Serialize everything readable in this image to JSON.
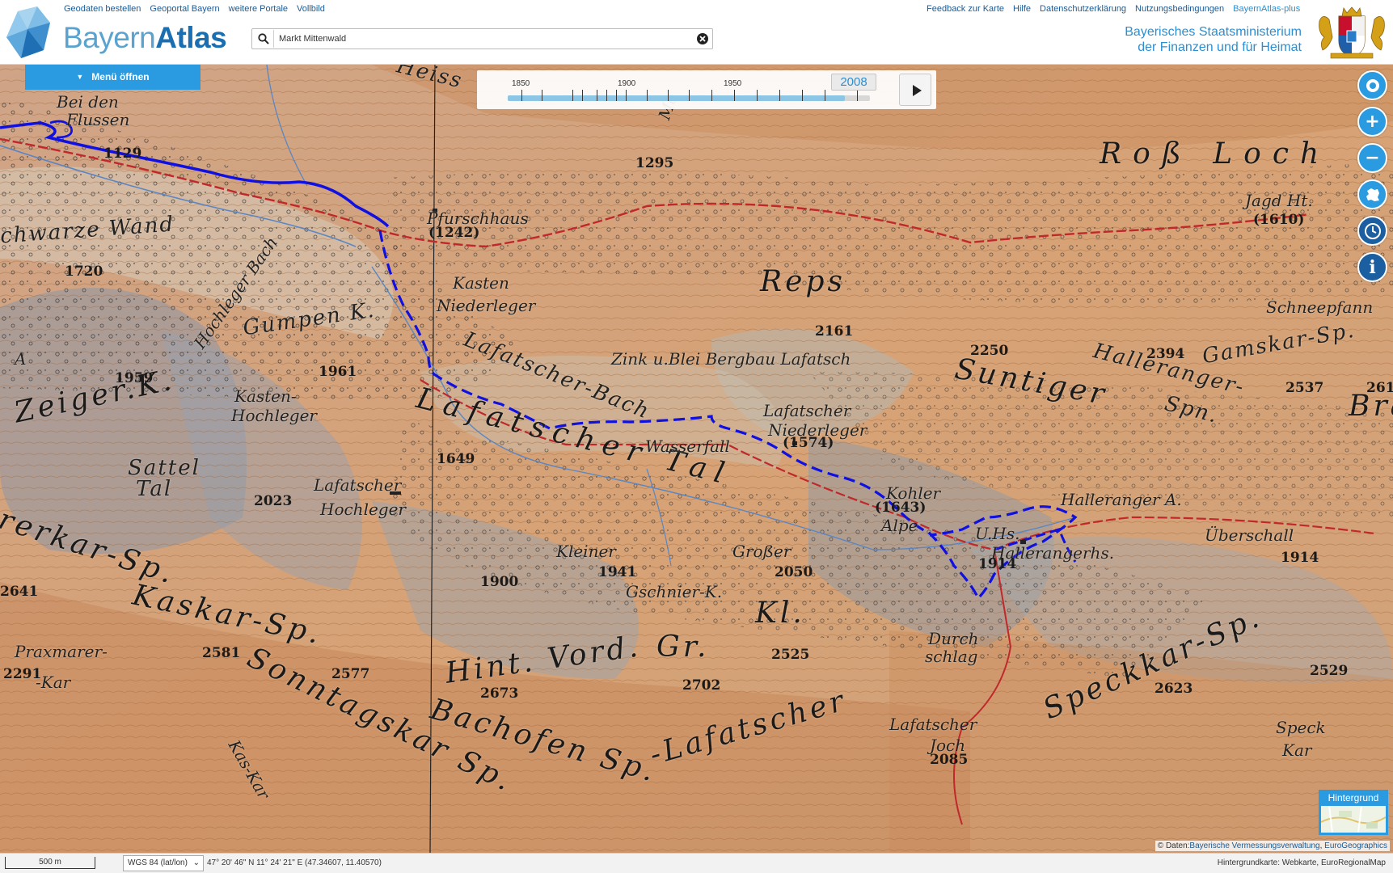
{
  "header": {
    "logo_bayern": "Bayern",
    "logo_atlas": "Atlas",
    "left_links": [
      "Geodaten bestellen",
      "Geoportal Bayern",
      "weitere Portale",
      "Vollbild"
    ],
    "right_links": [
      "Feedback zur Karte",
      "Hilfe",
      "Datenschutzerklärung",
      "Nutzungsbedingungen",
      "BayernAtlas-plus"
    ],
    "search": {
      "value": "Markt Mittenwald",
      "icon": "search-icon",
      "clear_icon": "close-circle-icon"
    },
    "ministry_line1": "Bayerisches Staatsministerium",
    "ministry_line2": "der Finanzen und für Heimat"
  },
  "menu": {
    "label": "Menü öffnen",
    "icon": "caret-down-icon"
  },
  "time_slider": {
    "ticks": [
      "1850",
      "1900",
      "1950"
    ],
    "selected_year": "2008",
    "progress": 0.93,
    "play_icon": "play-icon"
  },
  "controls": [
    {
      "name": "locate-button",
      "icon": "target-icon"
    },
    {
      "name": "zoom-in-button",
      "icon": "plus-icon"
    },
    {
      "name": "zoom-out-button",
      "icon": "minus-icon"
    },
    {
      "name": "bavaria-extent-button",
      "icon": "bavaria-shape-icon"
    },
    {
      "name": "time-travel-button",
      "icon": "clock-icon"
    },
    {
      "name": "info-button",
      "icon": "info-icon"
    }
  ],
  "map": {
    "labels": {
      "heisse": "Heiss",
      "bei_den": "Bei den",
      "flussen": "Flussen",
      "schwarze_wand": "chwarze Wand",
      "pfurschhaus": "Pfurschhaus",
      "kasten": "Kasten",
      "niederleger": "Niederleger",
      "reps": "Reps",
      "ross_loch": "Roß Loch",
      "jagd_ht": "Jagd Ht.",
      "hochleger_bach": "Hochleger Bach",
      "gumpen_k": "Gumpen K.",
      "zink_bergbau": "Zink u.Blei Bergbau Lafatsch",
      "suntiger": "Suntiger",
      "halleranger_spn": "Halleranger-",
      "spn": "Spn.",
      "gamskar_sp": "Gamskar-Sp.",
      "schneepfann": "Schneepfann",
      "zeiger_k": "Zeiger.K.",
      "kasten_hochleger_1": "Kasten-",
      "kasten_hochleger_2": "Hochleger",
      "lafatscher_bach": "Lafatscher-Bach",
      "lafatscher_niederleger_1": "Lafatscher",
      "lafatscher_niederleger_2": "Niederleger",
      "lafatscher_tal": "Lafatscher Tal",
      "wasserfall": "Wasserfall",
      "sattel_tal_1": "Sattel",
      "sattel_tal_2": "Tal",
      "lafatscher_hochleger_1": "Lafatscher",
      "lafatscher_hochleger_2": "Hochleger",
      "kohler_alpe_1": "Kohler",
      "kohler_alpe_2": "Alpe",
      "uhs": "U.Hs.",
      "halleranger_a": "Halleranger A.",
      "hallerangerhs": "Hallerangerhs.",
      "uberschall": "Überschall",
      "kleiner": "Kleiner",
      "grosser": "Großer",
      "gschnier_k": "Gschnier-K.",
      "kl": "Kl.",
      "gr": "Gr.",
      "hint_vord": "Hint. Vord.",
      "kaskar_sp": "Kaskar-Sp.",
      "praxmarer_1": "Praxmarer-",
      "praxmarer_2": "-Kar",
      "sonntagskar_sp": "Sonntagskar Sp.",
      "bachofen_sp": "Bachofen Sp.",
      "lafatscher_big": "-Lafatscher",
      "speckkar_sp": "Speckkar-Sp.",
      "durch_schlag_1": "Durch",
      "durch_schlag_2": "schlag",
      "lafatscher_joch_1": "Lafatscher",
      "lafatscher_joch_2": "Joch",
      "speck_kar_1": "Speck",
      "speck_kar_2": "Kar",
      "erkar_sp": "rerkar-Sp.",
      "kas_kar": "Kas-Kar",
      "bra": "Bra",
      "a_left": "A",
      "moa": "Mo"
    },
    "elevations": {
      "e1129": "1129",
      "e1295": "1295",
      "e1242": "(1242)",
      "e1610": "(1610)",
      "e1720": "1720",
      "e2161": "2161",
      "e2250": "2250",
      "e2394": "2394",
      "e2537": "2537",
      "e261": "261",
      "e1959": "1959",
      "e1961": "1961",
      "e1649": "1649",
      "e1574": "(1574)",
      "e2023": "2023",
      "e1643": "(1643)",
      "e1914a": "1914",
      "e1914b": "1914",
      "e1941": "1941",
      "e2050": "2050",
      "e1900": "1900",
      "e2641": "2641",
      "e2581": "2581",
      "e2291": "2291",
      "e2577": "2577",
      "e2673": "2673",
      "e2702": "2702",
      "e2525": "2525",
      "e2529": "2529",
      "e2623": "2623",
      "e2085": "2085"
    },
    "route_color": "#1010e0",
    "path_color": "#c0282b",
    "relief_color": "#d9a677"
  },
  "background_switch": {
    "label": "Hintergrund"
  },
  "attribution": {
    "prefix": "© Daten:",
    "source1": "Bayerische Vermessungsverwaltung",
    "sep": ",",
    "source2": "EuroGeographics"
  },
  "footer": {
    "scale": "500 m",
    "crs": "WGS 84 (lat/lon)",
    "coordinates": "47° 20' 46\" N 11° 24' 21\" E (47.34607, 11.40570)",
    "background_info": "Hintergrundkarte: Webkarte, EuroRegionalMap"
  }
}
